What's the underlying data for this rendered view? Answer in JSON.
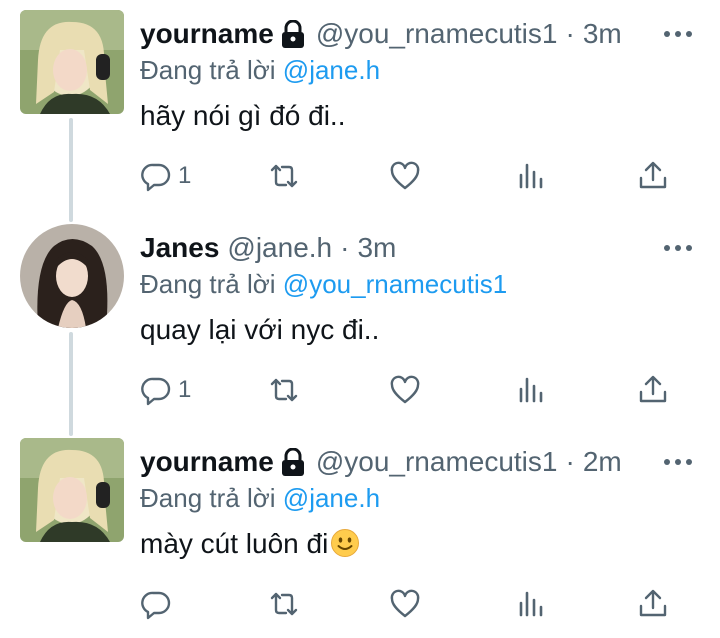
{
  "tweets": [
    {
      "name": "yourname",
      "handle": "@you_rnamecutis1",
      "separator": "·",
      "time": "3m",
      "reply_prefix": "Đang trả lời",
      "reply_to": "@jane.h",
      "text": "hãy nói gì đó đi..",
      "reply_count": "1"
    },
    {
      "name": "Janes",
      "handle": "@jane.h",
      "separator": "·",
      "time": "3m",
      "reply_prefix": "Đang trả lời",
      "reply_to": "@you_rnamecutis1",
      "text": "quay lại với nyc đi..",
      "reply_count": "1"
    },
    {
      "name": "yourname",
      "handle": "@you_rnamecutis1",
      "separator": "·",
      "time": "2m",
      "reply_prefix": "Đang trả lời",
      "reply_to": "@jane.h",
      "text": "mày cút luôn đi",
      "reply_count": ""
    }
  ],
  "colors": {
    "accent": "#1d9bf0",
    "secondary_text": "#536471",
    "icon": "#536471",
    "thread_line": "#cfd9de"
  },
  "icons": [
    "lock-icon",
    "more-icon",
    "reply-icon",
    "retweet-icon",
    "like-icon",
    "views-icon",
    "share-icon",
    "smile-emoji-icon"
  ]
}
